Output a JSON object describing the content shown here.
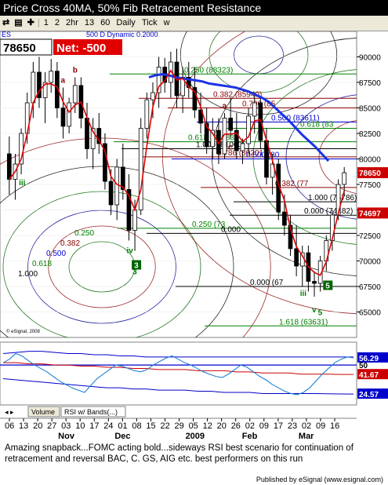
{
  "window": {
    "title": "Price Cross 40MA, 50% Fib Retracement Resistance"
  },
  "toolbar": {
    "items": [
      {
        "label": "⇄",
        "name": "link-icon"
      },
      {
        "label": "▤",
        "name": "properties-icon"
      },
      {
        "label": "✚",
        "name": "crosshair-icon"
      },
      {
        "label": "|",
        "name": "separator"
      },
      {
        "label": "1",
        "name": "interval-1"
      },
      {
        "label": "2",
        "name": "interval-2"
      },
      {
        "label": "2hr",
        "name": "interval-2hr"
      },
      {
        "label": "13",
        "name": "interval-13"
      },
      {
        "label": "60",
        "name": "interval-60"
      },
      {
        "label": "Daily",
        "name": "interval-daily"
      },
      {
        "label": "Tick",
        "name": "interval-tick"
      },
      {
        "label": "w",
        "name": "interval-w"
      }
    ]
  },
  "quote": {
    "price": "78650",
    "net": "Net: -500"
  },
  "symbol_fragment": "ES",
  "study_label": "500 D Dynamic 0.2000",
  "chart_data": {
    "type": "candlestick",
    "price_axis": {
      "min": 62500,
      "max": 92500,
      "ticks": [
        "90000",
        "87500",
        "85000",
        "82500",
        "80000",
        "77500",
        "75000",
        "72500",
        "70000",
        "67500",
        "65000"
      ]
    },
    "price_markers": [
      {
        "value": 78650,
        "label": "78650",
        "color": "#cc0000"
      },
      {
        "value": 74697,
        "label": "74697",
        "color": "#cc0000"
      }
    ],
    "x_day_ticks": [
      "06",
      "13",
      "20",
      "27",
      "03",
      "10",
      "17",
      "24",
      "01",
      "08",
      "15",
      "22",
      "29",
      "05",
      "12",
      "20",
      "26",
      "02",
      "09",
      "17",
      "23",
      "02",
      "09",
      "16"
    ],
    "x_month_labels": [
      "Nov",
      "Dec",
      "2009",
      "Feb",
      "Mar"
    ],
    "candles": [
      [
        80500,
        82200,
        76500,
        78000
      ],
      [
        78000,
        80500,
        76000,
        79500
      ],
      [
        79500,
        83000,
        78500,
        82500
      ],
      [
        82500,
        86500,
        81500,
        85500
      ],
      [
        85500,
        89500,
        84000,
        88500
      ],
      [
        88500,
        90000,
        85000,
        86000
      ],
      [
        86000,
        88500,
        83500,
        87500
      ],
      [
        87500,
        89800,
        86500,
        88600
      ],
      [
        88600,
        89500,
        84000,
        85000
      ],
      [
        85000,
        87000,
        82000,
        83200
      ],
      [
        83200,
        86000,
        82500,
        85500
      ],
      [
        85500,
        88000,
        84500,
        87200
      ],
      [
        87200,
        88000,
        83000,
        84000
      ],
      [
        84000,
        85500,
        80000,
        81000
      ],
      [
        81000,
        84000,
        79000,
        83000
      ],
      [
        83000,
        84500,
        80500,
        81500
      ],
      [
        81500,
        82500,
        77000,
        77800
      ],
      [
        77800,
        79000,
        74500,
        75500
      ],
      [
        75500,
        80000,
        74000,
        79200
      ],
      [
        79200,
        81500,
        76000,
        77000
      ],
      [
        77000,
        78500,
        72000,
        73000
      ],
      [
        73000,
        76000,
        71000,
        75000
      ],
      [
        75000,
        84000,
        74500,
        83000
      ],
      [
        83000,
        86500,
        82000,
        85800
      ],
      [
        85800,
        87500,
        84000,
        86500
      ],
      [
        86500,
        90000,
        85000,
        89000
      ],
      [
        89000,
        89900,
        86500,
        87500
      ],
      [
        87500,
        90500,
        86000,
        89500
      ],
      [
        89500,
        90800,
        85000,
        86200
      ],
      [
        86200,
        89000,
        84500,
        88000
      ],
      [
        88000,
        89500,
        86000,
        87000
      ],
      [
        87000,
        89000,
        84000,
        84800
      ],
      [
        84800,
        86500,
        82500,
        83500
      ],
      [
        83500,
        85000,
        80500,
        81200
      ],
      [
        81200,
        84000,
        80000,
        82800
      ],
      [
        82800,
        84000,
        79500,
        80500
      ],
      [
        80500,
        84500,
        80000,
        84000
      ],
      [
        84000,
        86000,
        82000,
        82800
      ],
      [
        82800,
        84500,
        80000,
        80800
      ],
      [
        80800,
        82000,
        79500,
        81500
      ],
      [
        81500,
        85000,
        80500,
        84200
      ],
      [
        84200,
        86500,
        82500,
        85500
      ],
      [
        85500,
        86000,
        81000,
        81800
      ],
      [
        81800,
        83000,
        77500,
        78200
      ],
      [
        78200,
        80500,
        76500,
        79500
      ],
      [
        79500,
        80000,
        74000,
        74800
      ],
      [
        74800,
        76500,
        72500,
        73500
      ],
      [
        73500,
        74500,
        70500,
        71200
      ],
      [
        71200,
        73500,
        68500,
        69500
      ],
      [
        69500,
        71500,
        67500,
        70800
      ],
      [
        70800,
        71500,
        67000,
        68000
      ],
      [
        68000,
        69000,
        66500,
        67800
      ],
      [
        67800,
        70500,
        67000,
        70000
      ],
      [
        70000,
        72500,
        69000,
        72000
      ],
      [
        72000,
        75000,
        71000,
        74500
      ],
      [
        74500,
        78000,
        74000,
        77500
      ],
      [
        77500,
        79200,
        76500,
        78650
      ]
    ],
    "moving_average_40": [
      88000,
      88200,
      88300,
      88200,
      88000,
      87900,
      87800,
      87700,
      87600,
      87400,
      87300,
      87200,
      87100,
      87000,
      86800,
      86600,
      86300,
      86000,
      85600,
      85000,
      84400,
      83800,
      83100,
      82400,
      81800,
      81200,
      80500,
      79800
    ],
    "fib_levels_upper": [
      {
        "value": 88323,
        "label": "0.250 (88323)",
        "color": "#008000"
      },
      {
        "value": 85940,
        "label": "0.382 (85940)",
        "color": "#8b0000"
      },
      {
        "value": 85000,
        "label": "0.700 (85",
        "color": "#8b0000"
      },
      {
        "value": 83611,
        "label": "0.500 (83611)",
        "color": "#0000cc"
      },
      {
        "value": 83000,
        "label": "0.618 (83",
        "color": "#008000"
      },
      {
        "value": 81683,
        "label": "0.618 (81683)",
        "color": "#008000"
      },
      {
        "value": 80201,
        "label": "0.786 (80201)",
        "color": "#8b0000"
      },
      {
        "value": 80000,
        "label": "0.500 (80",
        "color": "#0000cc"
      },
      {
        "value": 77200,
        "label": "0.382 (77",
        "color": "#8b0000"
      },
      {
        "value": 74482,
        "label": "0.000 (74482)",
        "color": "#000"
      },
      {
        "value": 73200,
        "label": "0.250 (73",
        "color": "#008000"
      },
      {
        "value": 72700,
        "label": "0.000",
        "color": "#000"
      },
      {
        "value": 67500,
        "label": "0.000 (67",
        "color": "#000"
      },
      {
        "value": 63631,
        "label": "1.618 (63631)",
        "color": "#008000"
      },
      {
        "value": 75800,
        "label": "1.000 (75786)",
        "color": "#000"
      },
      {
        "value": 81000,
        "label": "1.000 (81000)",
        "color": "#000"
      }
    ],
    "fan_labels": [
      {
        "label": "0.250",
        "color": "#008000"
      },
      {
        "label": "0.382",
        "color": "#8b0000"
      },
      {
        "label": "0.500",
        "color": "#0000cc"
      },
      {
        "label": "0.618",
        "color": "#008000"
      },
      {
        "label": "1.000",
        "color": "#000"
      }
    ],
    "wave_labels": [
      {
        "label": "iii",
        "color": "#008000"
      },
      {
        "label": "iv",
        "color": "#008000"
      },
      {
        "label": "v",
        "color": "#008000"
      },
      {
        "label": "3",
        "color": "#008000"
      },
      {
        "label": "a",
        "color": "#8b0000"
      },
      {
        "label": "b",
        "color": "#8b0000"
      },
      {
        "label": "a",
        "color": "#8b0000"
      },
      {
        "label": "c",
        "color": "#8b0000"
      },
      {
        "label": "iii",
        "color": "#008000"
      },
      {
        "label": "v",
        "color": "#008000"
      },
      {
        "label": "5",
        "color": "#008000"
      }
    ],
    "boxed_labels": [
      "3",
      "5"
    ],
    "watermark": "© eSignal, 2008",
    "rsi_panel": {
      "levels": [
        "56.29",
        "50",
        "41.67",
        "24.57"
      ],
      "level_colors": [
        "#0000cc",
        "#000",
        "#cc0000",
        "#0000cc"
      ],
      "rsi": [
        52,
        55,
        60,
        58,
        54,
        50,
        47,
        44,
        40,
        36,
        33,
        30,
        28,
        26,
        32,
        38,
        42,
        46,
        50,
        49,
        47,
        45,
        44,
        46,
        50,
        53,
        56,
        58,
        55,
        52,
        50,
        47,
        44,
        42,
        40,
        39,
        42,
        46,
        50,
        48,
        44,
        40,
        37,
        33,
        30,
        27,
        25,
        24,
        26,
        30,
        36,
        42,
        47,
        52,
        55,
        57,
        56.3
      ],
      "upper_band": [
        60,
        61,
        62,
        62,
        61,
        60,
        60,
        59,
        59,
        58,
        58,
        57,
        57,
        57,
        57,
        57,
        57,
        57,
        57,
        57,
        57,
        57,
        57,
        57,
        57,
        57,
        57,
        57
      ],
      "middle_band": [
        52,
        52,
        51,
        51,
        50,
        50,
        49,
        49,
        48,
        48,
        47,
        47,
        46,
        46,
        46,
        45,
        45,
        45,
        44,
        44,
        43,
        43,
        43,
        42,
        42,
        42,
        41.7,
        41.7
      ],
      "lower_band": [
        38,
        37,
        36,
        35,
        34,
        33,
        32,
        31,
        30,
        30,
        29,
        29,
        28,
        28,
        28,
        27,
        27,
        26,
        26,
        26,
        25,
        25,
        25,
        25,
        25,
        24.8,
        24.6,
        24.57
      ]
    },
    "tabs": [
      "Volume",
      "RSI w/ Bands(...)"
    ]
  },
  "caption": "Amazing snapback...FOMC  acting bold...sideways RSI best scenario for continuation of retracement and reversal  BAC, C. GS, AIG etc. best performers on this run",
  "footer": "Published by eSignal (www.esignal.com)"
}
